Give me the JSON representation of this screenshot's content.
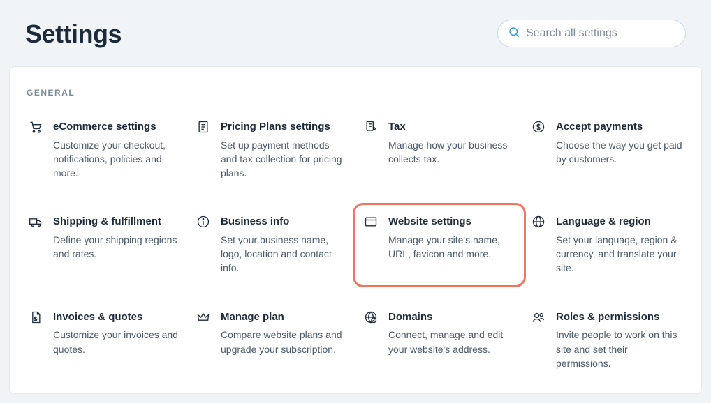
{
  "page_title": "Settings",
  "search": {
    "placeholder": "Search all settings"
  },
  "section_label": "GENERAL",
  "cards": [
    {
      "id": "ecommerce",
      "icon": "cart",
      "title": "eCommerce settings",
      "desc": "Customize your checkout, notifications, policies and more.",
      "highlight": false
    },
    {
      "id": "pricing-plans",
      "icon": "doc",
      "title": "Pricing Plans settings",
      "desc": "Set up payment methods and tax collection for pricing plans.",
      "highlight": false
    },
    {
      "id": "tax",
      "icon": "tax",
      "title": "Tax",
      "desc": "Manage how your business collects tax.",
      "highlight": false
    },
    {
      "id": "payments",
      "icon": "dollar",
      "title": "Accept payments",
      "desc": "Choose the way you get paid by customers.",
      "highlight": false
    },
    {
      "id": "shipping",
      "icon": "truck",
      "title": "Shipping & fulfillment",
      "desc": "Define your shipping regions and rates.",
      "highlight": false
    },
    {
      "id": "business",
      "icon": "info",
      "title": "Business info",
      "desc": "Set your business name, logo, location and contact info.",
      "highlight": false
    },
    {
      "id": "website",
      "icon": "browser",
      "title": "Website settings",
      "desc": "Manage your site's name, URL, favicon and more.",
      "highlight": true
    },
    {
      "id": "language",
      "icon": "globe",
      "title": "Language & region",
      "desc": "Set your language, region & currency, and translate your site.",
      "highlight": false
    },
    {
      "id": "invoices",
      "icon": "invoice",
      "title": "Invoices & quotes",
      "desc": "Customize your invoices and quotes.",
      "highlight": false
    },
    {
      "id": "plan",
      "icon": "crown",
      "title": "Manage plan",
      "desc": "Compare website plans and upgrade your subscription.",
      "highlight": false
    },
    {
      "id": "domains",
      "icon": "domain",
      "title": "Domains",
      "desc": "Connect, manage and edit your website's address.",
      "highlight": false
    },
    {
      "id": "roles",
      "icon": "people",
      "title": "Roles & permissions",
      "desc": "Invite people to work on this site and set their permissions.",
      "highlight": false
    }
  ]
}
